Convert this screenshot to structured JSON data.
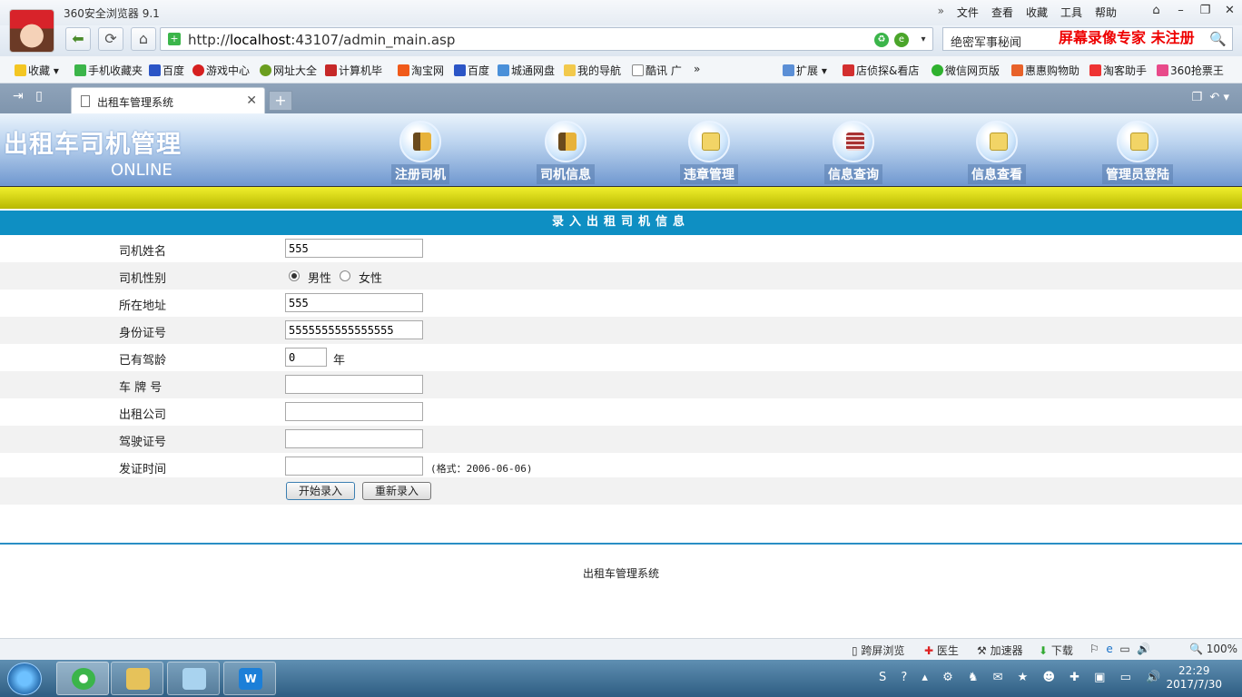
{
  "browser": {
    "title": "360安全浏览器 9.1",
    "menu": [
      "»",
      "文件",
      "查看",
      "收藏",
      "工具",
      "帮助"
    ],
    "url_prefix": "http://",
    "url_host": "localhost",
    "url_rest": ":43107/admin_main.asp",
    "search_query": "绝密军事秘闻",
    "watermark": "屏幕录像专家  未注册"
  },
  "bookmarks": [
    "收藏",
    "手机收藏夹",
    "百度",
    "游戏中心",
    "网址大全",
    "计算机毕",
    "淘宝网",
    "百度",
    "城通网盘",
    "我的导航",
    "酷讯 广",
    "»",
    "扩展",
    "店侦探&看店",
    "微信网页版",
    "惠惠购物助",
    "淘客助手",
    "360抢票王"
  ],
  "tab": {
    "title": "出租车管理系统"
  },
  "site": {
    "title": "出租车司机管理",
    "subtitle": "ONLINE",
    "nav": [
      "注册司机",
      "司机信息",
      "违章管理",
      "信息查询",
      "信息查看",
      "管理员登陆"
    ]
  },
  "form": {
    "heading": "录入出租司机信息",
    "name_label": "司机姓名",
    "name_value": "555",
    "gender_label": "司机性别",
    "male": "男性",
    "female": "女性",
    "address_label": "所在地址",
    "address_value": "555",
    "id_label": "身份证号",
    "id_value": "5555555555555555",
    "years_label": "已有驾龄",
    "years_value": "0",
    "years_unit": "年",
    "plate_label": "车 牌 号",
    "plate_value": "",
    "company_label": "出租公司",
    "company_value": "",
    "license_label": "驾驶证号",
    "license_value": "",
    "issue_label": "发证时间",
    "issue_value": "",
    "issue_hint": "(格式：2006-06-06)",
    "submit": "开始录入",
    "reset": "重新录入"
  },
  "footer": "出租车管理系统",
  "statusbar": [
    "跨屏浏览",
    "医生",
    "加速器",
    "下载",
    "100%"
  ],
  "taskbar": {
    "time": "22:29",
    "date": "2017/7/30"
  }
}
